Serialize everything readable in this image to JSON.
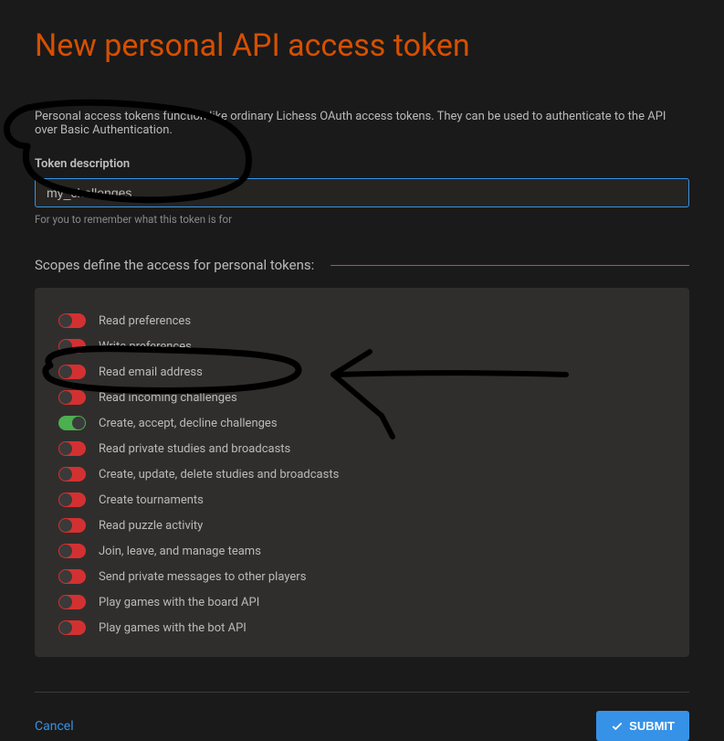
{
  "title": "New personal API access token",
  "description": "Personal access tokens function like ordinary Lichess OAuth access tokens. They can be used to authenticate to the API over Basic Authentication.",
  "token_description_label": "Token description",
  "token_description_value": "my_challenges",
  "token_description_helper": "For you to remember what this token is for",
  "scopes_header": "Scopes define the access for personal tokens:",
  "scopes": [
    {
      "label": "Read preferences",
      "enabled": false
    },
    {
      "label": "Write preferences",
      "enabled": false
    },
    {
      "label": "Read email address",
      "enabled": false
    },
    {
      "label": "Read incoming challenges",
      "enabled": false
    },
    {
      "label": "Create, accept, decline challenges",
      "enabled": true
    },
    {
      "label": "Read private studies and broadcasts",
      "enabled": false
    },
    {
      "label": "Create, update, delete studies and broadcasts",
      "enabled": false
    },
    {
      "label": "Create tournaments",
      "enabled": false
    },
    {
      "label": "Read puzzle activity",
      "enabled": false
    },
    {
      "label": "Join, leave, and manage teams",
      "enabled": false
    },
    {
      "label": "Send private messages to other players",
      "enabled": false
    },
    {
      "label": "Play games with the board API",
      "enabled": false
    },
    {
      "label": "Play games with the bot API",
      "enabled": false
    }
  ],
  "cancel_label": "Cancel",
  "submit_label": "SUBMIT"
}
